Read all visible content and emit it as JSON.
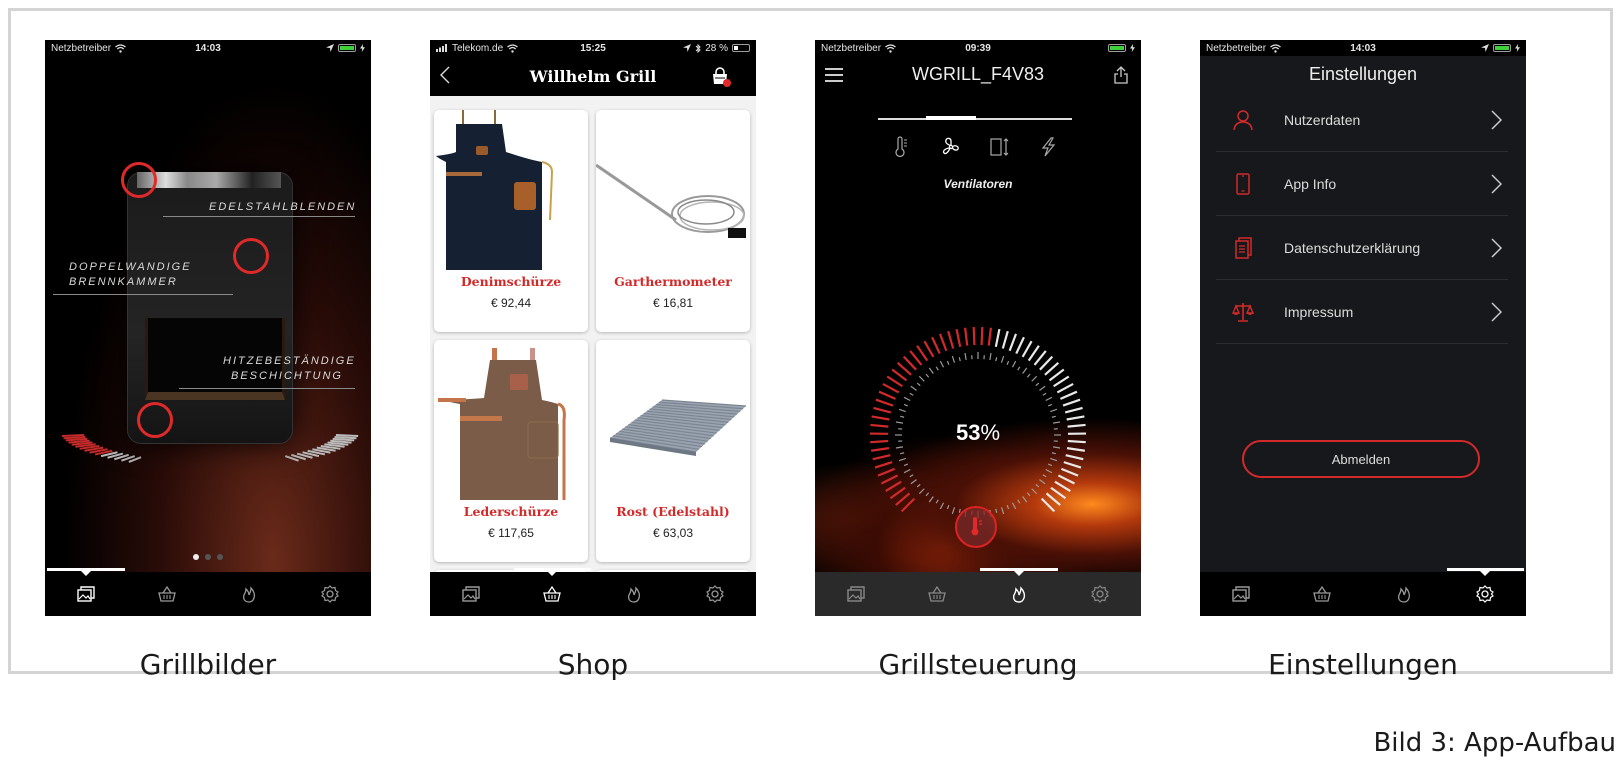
{
  "figure_caption": "Bild 3: App-Aufbau",
  "accent_color": "#d22a2a",
  "tabbar": {
    "items": [
      {
        "name": "gallery",
        "icon": "image-gallery-icon"
      },
      {
        "name": "shop",
        "icon": "shopping-basket-icon"
      },
      {
        "name": "grill-control",
        "icon": "flame-icon"
      },
      {
        "name": "settings",
        "icon": "gear-icon"
      }
    ]
  },
  "screens": [
    {
      "caption": "Grillbilder",
      "status": {
        "carrier": "Netzbetreiber",
        "time": "14:03"
      },
      "callouts": [
        "EDELSTAHLBLENDEN",
        "DOPPELWANDIGE\nBRENNKAMMER",
        "HITZEBESTÄNDIGE\nBESCHICHTUNG"
      ],
      "callout_lines": [
        [
          "EDELSTAHLBLENDEN"
        ],
        [
          "DOPPELWANDIGE",
          "BRENNKAMMER"
        ],
        [
          "HITZEBESTÄNDIGE",
          "BESCHICHTUNG"
        ]
      ],
      "pager": {
        "count": 3,
        "current": 1
      },
      "active_tab": 0
    },
    {
      "caption": "Shop",
      "status": {
        "carrier": "Telekom.de",
        "time": "15:25",
        "battery": "28 %"
      },
      "header_title": "Willhelm Grill",
      "back_label": "<",
      "products": [
        {
          "name": "Denimschürze",
          "price": "€ 92,44"
        },
        {
          "name": "Garthermometer",
          "price": "€ 16,81"
        },
        {
          "name": "Lederschürze",
          "price": "€ 117,65"
        },
        {
          "name": "Rost (Edelstahl)",
          "price": "€ 63,03"
        }
      ],
      "active_tab": 1
    },
    {
      "caption": "Grillsteuerung",
      "status": {
        "carrier": "Netzbetreiber",
        "time": "09:39"
      },
      "device_name": "WGRILL_F4V83",
      "modes": [
        {
          "name": "temperature",
          "icon": "thermometer-icon"
        },
        {
          "name": "fans",
          "icon": "fan-icon"
        },
        {
          "name": "lid",
          "icon": "lid-height-icon"
        },
        {
          "name": "power",
          "icon": "lightning-icon"
        }
      ],
      "active_mode": 1,
      "mode_label": "Ventilatoren",
      "gauge": {
        "value_number": "53",
        "value_unit": "%",
        "percent": 53
      },
      "active_tab": 2
    },
    {
      "caption": "Einstellungen",
      "status": {
        "carrier": "Netzbetreiber",
        "time": "14:03"
      },
      "title": "Einstellungen",
      "items": [
        {
          "label": "Nutzerdaten",
          "icon": "user-icon"
        },
        {
          "label": "App Info",
          "icon": "smartphone-icon"
        },
        {
          "label": "Datenschutzerklärung",
          "icon": "document-icon"
        },
        {
          "label": "Impressum",
          "icon": "scales-icon"
        }
      ],
      "logout_label": "Abmelden",
      "active_tab": 3
    }
  ]
}
